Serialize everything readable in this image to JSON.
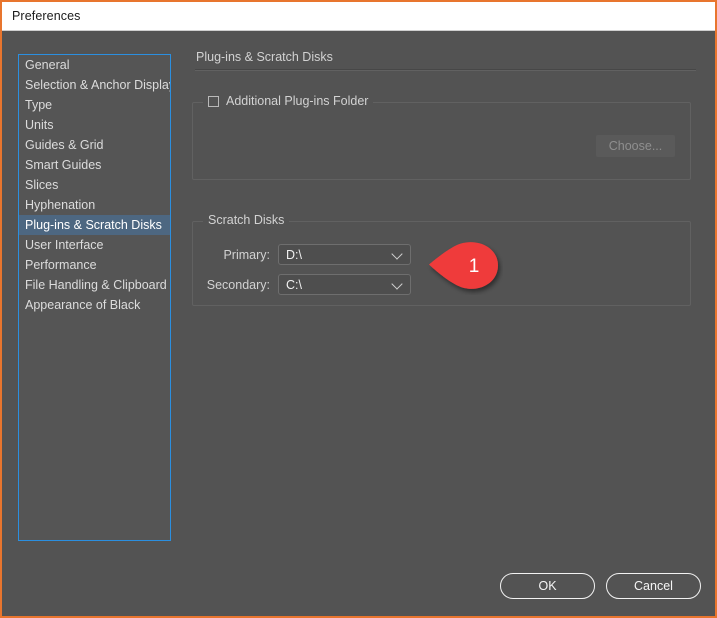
{
  "window": {
    "title": "Preferences",
    "border_color": "#e8752e",
    "background": "#535353"
  },
  "sidebar": {
    "items": [
      {
        "label": "General",
        "selected": false
      },
      {
        "label": "Selection & Anchor Display",
        "selected": false
      },
      {
        "label": "Type",
        "selected": false
      },
      {
        "label": "Units",
        "selected": false
      },
      {
        "label": "Guides & Grid",
        "selected": false
      },
      {
        "label": "Smart Guides",
        "selected": false
      },
      {
        "label": "Slices",
        "selected": false
      },
      {
        "label": "Hyphenation",
        "selected": false
      },
      {
        "label": "Plug-ins & Scratch Disks",
        "selected": true
      },
      {
        "label": "User Interface",
        "selected": false
      },
      {
        "label": "Performance",
        "selected": false
      },
      {
        "label": "File Handling & Clipboard",
        "selected": false
      },
      {
        "label": "Appearance of Black",
        "selected": false
      }
    ],
    "focus_border_color": "#2b8fe0",
    "selected_color": "#4d6781"
  },
  "panel": {
    "header": "Plug-ins & Scratch Disks",
    "plugins_group": {
      "legend": "Additional Plug-ins Folder",
      "checkbox_checked": false,
      "choose_button": {
        "label": "Choose...",
        "enabled": false
      }
    },
    "scratch_group": {
      "legend": "Scratch Disks",
      "rows": [
        {
          "label": "Primary:",
          "value": "D:\\"
        },
        {
          "label": "Secondary:",
          "value": "C:\\"
        }
      ]
    }
  },
  "annotation": {
    "number": "1",
    "color": "#ef3b3b"
  },
  "footer": {
    "ok_label": "OK",
    "cancel_label": "Cancel"
  }
}
